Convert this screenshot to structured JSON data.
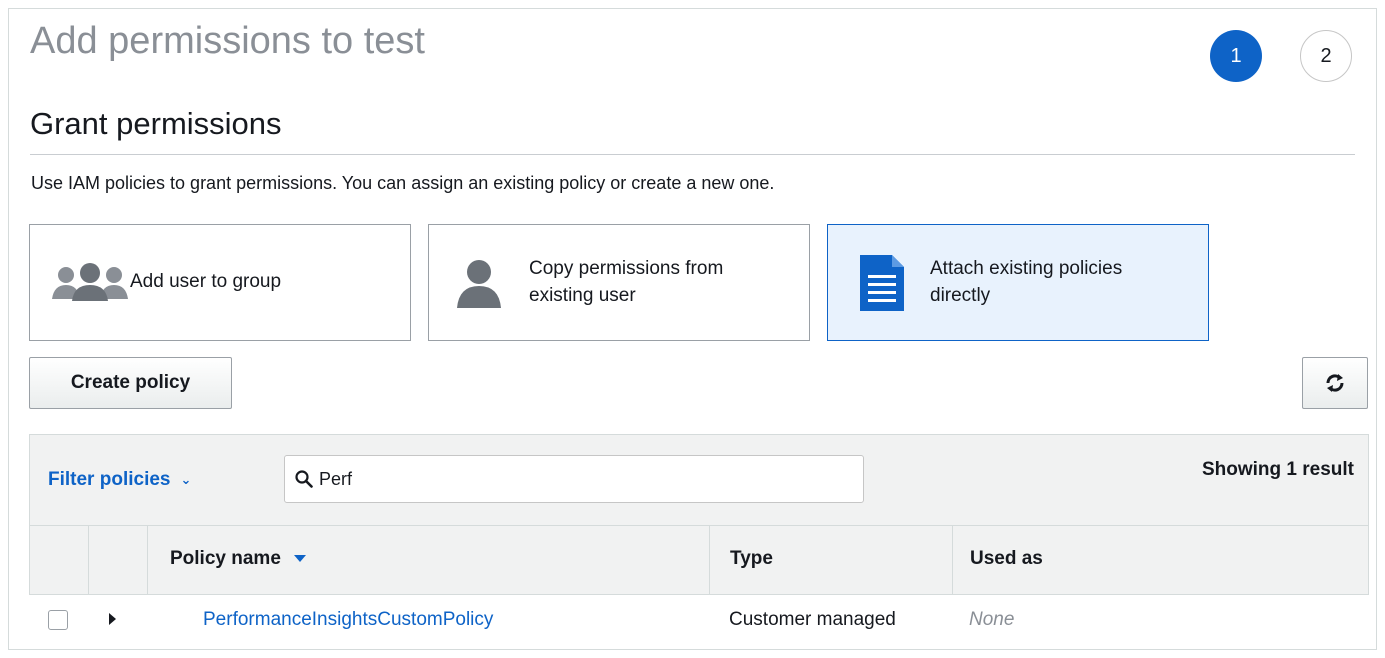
{
  "header": {
    "title": "Add permissions to test",
    "steps": [
      "1",
      "2"
    ]
  },
  "section": {
    "title": "Grant permissions",
    "description": "Use IAM policies to grant permissions. You can assign an existing policy or create a new one."
  },
  "options": [
    {
      "label": "Add user to group",
      "icon": "user-group-icon",
      "selected": false
    },
    {
      "label_line1": "Copy permissions from",
      "label_line2": "existing user",
      "icon": "user-icon",
      "selected": false
    },
    {
      "label_line1": "Attach existing policies",
      "label_line2": "directly",
      "icon": "document-icon",
      "selected": true
    }
  ],
  "toolbar": {
    "create_label": "Create policy",
    "refresh_icon": "refresh-icon"
  },
  "filter": {
    "label": "Filter policies",
    "search_value": "Perf",
    "result_count": "Showing 1 result"
  },
  "table": {
    "columns": [
      "Policy name",
      "Type",
      "Used as"
    ],
    "rows": [
      {
        "name": "PerformanceInsightsCustomPolicy",
        "type": "Customer managed",
        "used_as": "None"
      }
    ]
  },
  "colors": {
    "accent": "#0e63c7",
    "selected_bg": "#e8f2fd",
    "muted": "#8a8f96"
  }
}
